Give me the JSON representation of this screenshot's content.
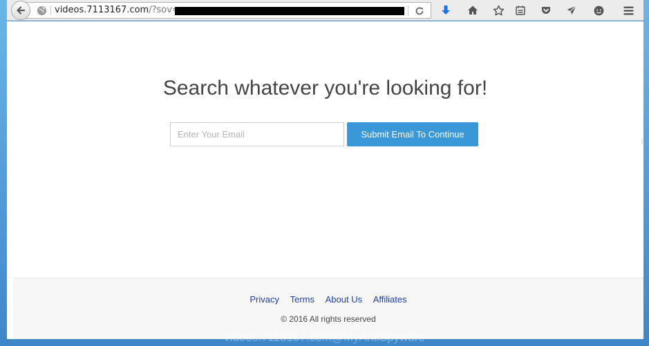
{
  "browser": {
    "url_host": "videos.7113167.com",
    "url_path": "/?sov=",
    "icons": [
      "back-arrow-icon",
      "globe-icon",
      "reload-icon",
      "download-icon",
      "home-icon",
      "bookmark-star-icon",
      "reading-list-icon",
      "pocket-icon",
      "send-icon",
      "chat-icon",
      "menu-icon"
    ],
    "accent_color": "#1a73e8"
  },
  "page": {
    "headline": "Search whatever you're looking for!",
    "email_placeholder": "Enter Your Email",
    "submit_label": "Submit Email To Continue",
    "submit_color": "#3a97d8"
  },
  "footer": {
    "links": [
      "Privacy",
      "Terms",
      "About Us",
      "Affiliates"
    ],
    "copyright": "© 2016 All rights reserved"
  },
  "watermark": "videos.7113167.com@MyAntiSpyware"
}
